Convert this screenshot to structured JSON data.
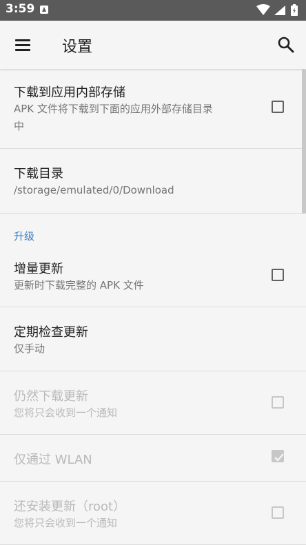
{
  "status_bar": {
    "time": "3:59",
    "icons": [
      "app-notification-icon",
      "wifi-icon",
      "signal-icon",
      "battery-icon"
    ]
  },
  "toolbar": {
    "title": "设置",
    "menu_icon": "menu-icon",
    "search_icon": "search-icon"
  },
  "colors": {
    "accent": "#3a7fc4",
    "status_bar": "#5a5a5a",
    "background": "#f5f5f5"
  },
  "prefs": {
    "internal_storage": {
      "title": "下载到应用内部存储",
      "summary_line1": "APK 文件将下载到下面的应用外部存储目录",
      "summary_line2": "中",
      "checked": false
    },
    "download_dir": {
      "title": "下载目录",
      "summary": "/storage/emulated/0/Download"
    },
    "category_upgrade": "升级",
    "delta_update": {
      "title": "增量更新",
      "summary": "更新时下载完整的 APK 文件",
      "checked": false
    },
    "periodic_check": {
      "title": "定期检查更新",
      "summary": "仅手动"
    },
    "still_download": {
      "title": "仍然下载更新",
      "summary": "您将只会收到一个通知",
      "checked": false,
      "enabled": false
    },
    "wlan_only": {
      "title": "仅通过 WLAN",
      "checked": true,
      "enabled": false
    },
    "install_root": {
      "title": "还安装更新（root）",
      "summary": "您将只会收到一个通知",
      "checked": false,
      "enabled": false
    }
  }
}
